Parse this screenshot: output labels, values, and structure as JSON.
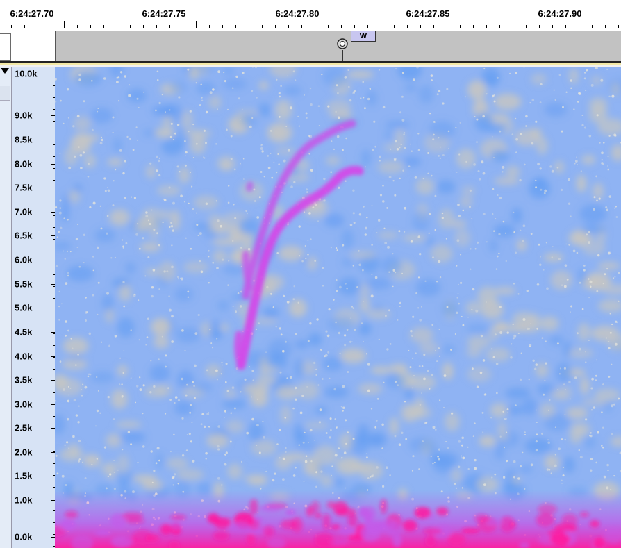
{
  "ruler": {
    "labels": [
      "6:24:27.70",
      "6:24:27.75",
      "6:24:27.80",
      "6:24:27.85",
      "6:24:27.90"
    ]
  },
  "label_track": {
    "label_text": "W"
  },
  "frequency_axis": {
    "labels": [
      "10.0k",
      "9.0k",
      "8.5k",
      "8.0k",
      "7.5k",
      "7.0k",
      "6.5k",
      "6.0k",
      "5.5k",
      "5.0k",
      "4.5k",
      "4.0k",
      "3.5k",
      "3.0k",
      "2.5k",
      "2.0k",
      "1.5k",
      "1.0k",
      "0.0k"
    ]
  },
  "colors": {
    "spectro_bg": "#8fb3f3",
    "noise_light": "#c9c7c0",
    "signal": "#e31fe0",
    "label_fill": "#c8c6f0",
    "ruler_area": "#c2c2c2"
  }
}
